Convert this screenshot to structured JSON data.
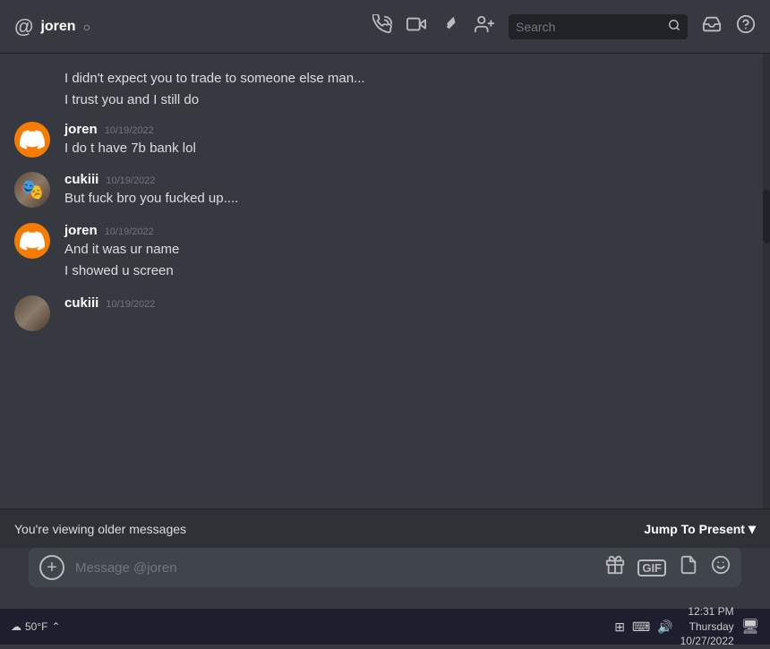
{
  "header": {
    "channel": "joren",
    "verified_icon": "○",
    "search_placeholder": "Search",
    "icons": {
      "call": "📞",
      "video": "📹",
      "pin": "📌",
      "add_member": "👤+",
      "inbox": "🗃",
      "help": "?"
    }
  },
  "messages": [
    {
      "id": "msg-continuation-1",
      "type": "continuation",
      "text": "I didn't expect you to trade to someone else man..."
    },
    {
      "id": "msg-continuation-2",
      "type": "continuation",
      "text": "I trust you and I still do"
    },
    {
      "id": "msg-joren-1",
      "type": "group",
      "avatar_type": "discord",
      "username": "joren",
      "timestamp": "10/19/2022",
      "messages": [
        "I do t have 7b bank lol"
      ]
    },
    {
      "id": "msg-cukiii-1",
      "type": "group",
      "avatar_type": "photo",
      "username": "cukiii",
      "timestamp": "10/19/2022",
      "messages": [
        "But fuck bro you fucked up...."
      ]
    },
    {
      "id": "msg-joren-2",
      "type": "group",
      "avatar_type": "discord",
      "username": "joren",
      "timestamp": "10/19/2022",
      "messages": [
        "And it was ur name",
        "I showed u screen"
      ]
    },
    {
      "id": "msg-cukiii-2",
      "type": "group",
      "avatar_type": "photo",
      "username": "cukiii",
      "timestamp": "10/19/2022",
      "messages": []
    }
  ],
  "jump_bar": {
    "text": "You're viewing older messages",
    "button": "Jump To Present"
  },
  "input": {
    "placeholder": "Message @joren"
  },
  "taskbar": {
    "temperature": "50°F",
    "time": "12:31 PM",
    "day": "Thursday",
    "date": "10/27/2022"
  }
}
